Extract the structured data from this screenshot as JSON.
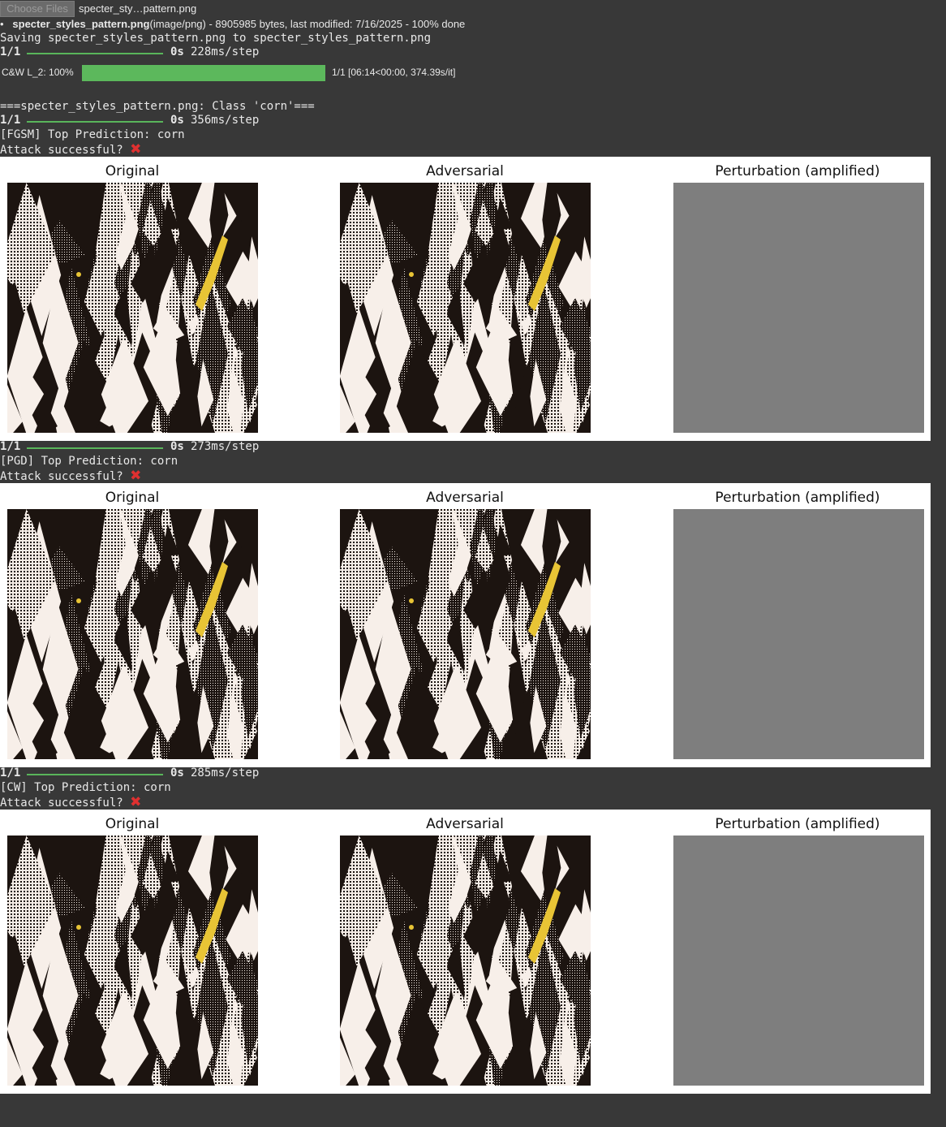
{
  "upload": {
    "button_label": "Choose Files",
    "chosen_name": "specter_sty…pattern.png",
    "file_bullet": "•",
    "file_name": "specter_styles_pattern.png",
    "file_meta": "(image/png) - 8905985 bytes, last modified: 7/16/2025 - 100% done"
  },
  "log": {
    "saving": "Saving specter_styles_pattern.png to specter_styles_pattern.png",
    "header": "===specter_styles_pattern.png: Class 'corn'===",
    "attack_q": "Attack successful? ",
    "x_glyph": "✖"
  },
  "steps": [
    {
      "count": "1/1",
      "time": "0s",
      "ms": "228ms/step"
    },
    {
      "count": "1/1",
      "time": "0s",
      "ms": "356ms/step"
    },
    {
      "count": "1/1",
      "time": "0s",
      "ms": "273ms/step"
    },
    {
      "count": "1/1",
      "time": "0s",
      "ms": "285ms/step"
    }
  ],
  "tqdm": {
    "label": "C&W L_2: 100%",
    "progress": 1.0,
    "stats": "1/1 [06:14<00:00, 374.39s/it]"
  },
  "attacks": [
    {
      "prediction": "[FGSM] Top Prediction: corn"
    },
    {
      "prediction": "[PGD] Top Prediction: corn"
    },
    {
      "prediction": "[CW] Top Prediction: corn"
    }
  ],
  "panel_titles": {
    "original": "Original",
    "adversarial": "Adversarial",
    "perturbation": "Perturbation (amplified)"
  },
  "colors": {
    "success_bar": "#5cb85c",
    "fail_mark": "#e03030",
    "perturbation_gray": "#7e7e7e"
  }
}
